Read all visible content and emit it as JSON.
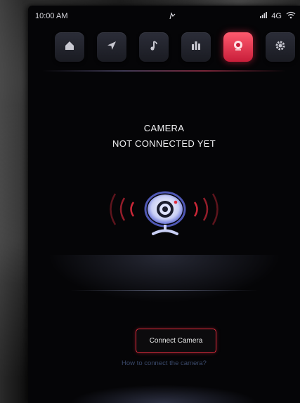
{
  "status_bar": {
    "time": "10:00 AM",
    "network": "4G",
    "center_icon": "cursor-tap-icon",
    "icons": [
      "signal-icon",
      "wifi-icon"
    ]
  },
  "nav": {
    "items": [
      {
        "name": "home",
        "icon": "home-icon",
        "active": false
      },
      {
        "name": "navigation",
        "icon": "navigation-arrow-icon",
        "active": false
      },
      {
        "name": "music",
        "icon": "music-note-icon",
        "active": false
      },
      {
        "name": "equalizer",
        "icon": "equalizer-icon",
        "active": false
      },
      {
        "name": "camera",
        "icon": "camera-icon",
        "active": true
      },
      {
        "name": "settings",
        "icon": "gear-icon",
        "active": false
      }
    ]
  },
  "main": {
    "title_line1": "CAMERA",
    "title_line2": "NOT CONNECTED YET",
    "connect_button_label": "Connect Camera",
    "help_link": "How to connect the camera?"
  },
  "colors": {
    "accent": "#e02b3d",
    "background": "#050507",
    "link": "#3b4a6b"
  }
}
